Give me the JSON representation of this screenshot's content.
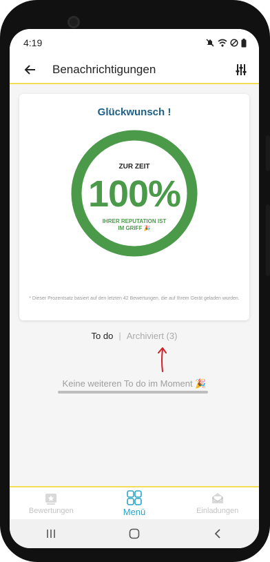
{
  "status": {
    "time": "4:19"
  },
  "appbar": {
    "title": "Benachrichtigungen"
  },
  "card": {
    "heading": "Glückwunsch !",
    "current_label": "ZUR ZEIT",
    "percent": "100%",
    "progress": 1.0,
    "reputation_line1": "IHRER REPUTATION IST",
    "reputation_line2": "IM GRIFF 🎉",
    "footnote": "* Dieser Prozentsatz basiert auf den letzten 42 Bewertungen, die auf Ihrem Gerät geladen wurden."
  },
  "tabs": {
    "todo": "To do",
    "separator": "|",
    "archived": "Archiviert (3)"
  },
  "empty_state": {
    "message": "Keine weiteren To do im Moment 🎉"
  },
  "bottom_nav": {
    "items": [
      {
        "label": "Bewertungen",
        "icon": "reviews-icon",
        "active": false
      },
      {
        "label": "Menü",
        "icon": "menu-grid-icon",
        "active": true
      },
      {
        "label": "Einladungen",
        "icon": "invitation-icon",
        "active": false
      }
    ]
  },
  "colors": {
    "accent_yellow": "#f2dd55",
    "ring_green": "#4a9a4a",
    "heading_blue": "#1e5f86",
    "active_nav": "#2aa3c9",
    "annotation_red": "#d0202a"
  }
}
